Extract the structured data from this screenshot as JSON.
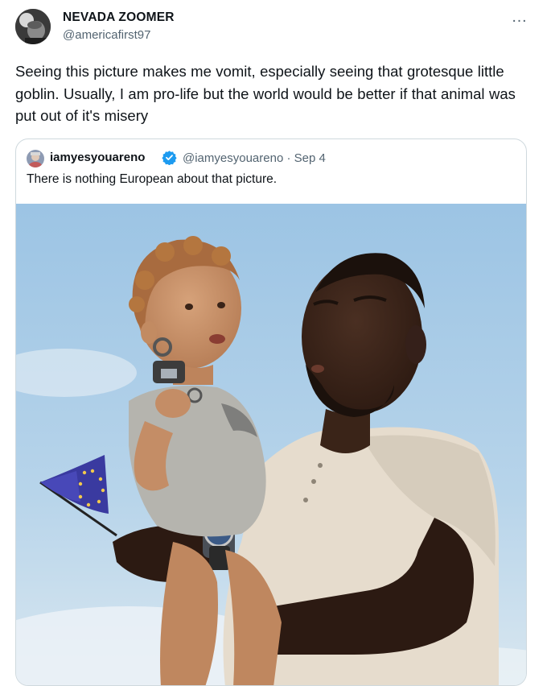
{
  "author": {
    "display_name": "NEVADA ZOOMER",
    "handle": "@americafirst97"
  },
  "tweet": {
    "text": "Seeing this picture makes me vomit, especially seeing that grotesque little goblin. Usually, I am pro-life but the world would be better if that animal was put out of it's misery"
  },
  "more_icon": "…",
  "quoted": {
    "display_name": "iamyesyouareno",
    "meta": "@iamyesyouareno · Sep 4",
    "text": "There is nothing European about that picture.",
    "verified_color": "#1d9bf0"
  },
  "media": {
    "description_icon": "photo-icon"
  }
}
